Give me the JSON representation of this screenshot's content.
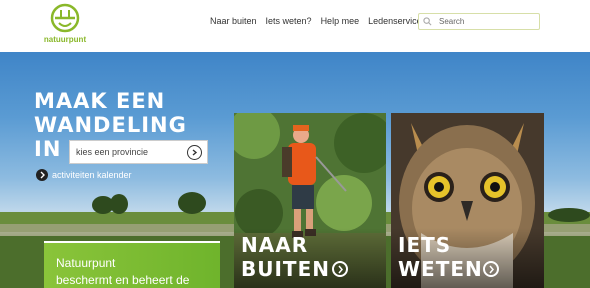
{
  "brand": {
    "name": "natuurpunt",
    "accent": "#8ab82a"
  },
  "nav": {
    "items": [
      {
        "label": "Naar buiten"
      },
      {
        "label": "Iets weten?"
      },
      {
        "label": "Help mee"
      },
      {
        "label": "Ledenservice"
      }
    ]
  },
  "search": {
    "placeholder": "Search",
    "icon": "search-icon"
  },
  "hero": {
    "headline_line1": "MAAK EEN",
    "headline_line2": "WANDELING",
    "headline_line3": "IN",
    "province_placeholder": "kies een provincie",
    "calendar_link": "activiteiten kalender"
  },
  "promo": {
    "line1": "Natuurpunt",
    "line2": "beschermt en beheert de"
  },
  "tiles": [
    {
      "line1": "NAAR",
      "line2": "BUITEN"
    },
    {
      "line1": "IETS",
      "line2": "WETEN"
    }
  ],
  "colors": {
    "green": "#8ac43a",
    "sky": "#3c82c6"
  }
}
